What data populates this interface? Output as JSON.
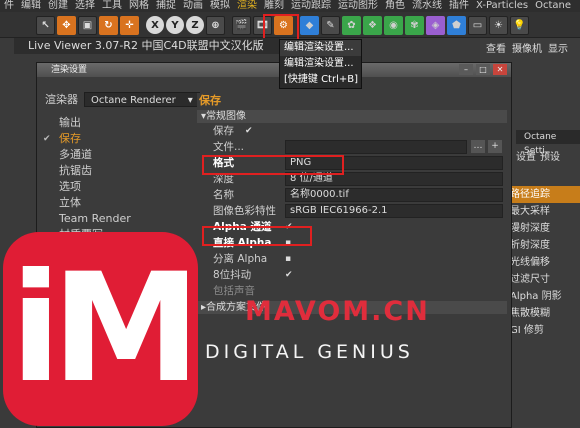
{
  "menubar": [
    "件",
    "编辑",
    "创建",
    "选择",
    "工具",
    "网格",
    "捕捉",
    "动画",
    "模拟",
    "渲染",
    "雕刻",
    "运动跟踪",
    "运动图形",
    "角色",
    "流水线",
    "插件",
    "X-Particles",
    "Octane"
  ],
  "toolbar": {
    "x": "X",
    "y": "Y",
    "z": "Z"
  },
  "popup": {
    "item1": "编辑渲染设置...",
    "item2": "编辑渲染设置...",
    "item3": "[快捷键 Ctrl+B]"
  },
  "live_viewer_title": "Live Viewer 3.07-R2 中国C4D联盟中文汉化版",
  "right_panel": {
    "tabs": [
      "查看",
      "摄像机",
      "显示"
    ],
    "octane_title": "Octane Setti...",
    "octane_tabs": [
      "设置",
      "预设"
    ],
    "list": [
      "路径追踪",
      "最大采样",
      "漫射深度",
      "折射深度",
      "光线偏移",
      "过滤尺寸",
      "Alpha 阴影",
      "焦散模糊",
      "GI 修剪"
    ]
  },
  "dialog": {
    "title": "渲染设置",
    "renderer_label": "渲染器",
    "renderer_value": "Octane Renderer",
    "nav": [
      {
        "label": "输出",
        "checked": false
      },
      {
        "label": "保存",
        "checked": true
      },
      {
        "label": "多通道",
        "checked": false
      },
      {
        "label": "抗锯齿",
        "checked": false
      },
      {
        "label": "选项",
        "checked": false
      },
      {
        "label": "立体",
        "checked": false
      },
      {
        "label": "Team Render",
        "checked": false
      },
      {
        "label": "材质覆写",
        "checked": false
      }
    ],
    "pane_title": "保存",
    "section_general": "常规图像",
    "rows": {
      "save": "保存",
      "file": "文件...",
      "format": "格式",
      "format_value": "PNG",
      "depth": "深度",
      "depth_value": "8 位/通道",
      "name": "名称",
      "name_value": "名称0000.tif",
      "color_profile": "图像色彩特性",
      "color_profile_value": "sRGB IEC61966-2.1",
      "alpha": "Alpha 通道",
      "straight_alpha": "直接 Alpha",
      "separate_alpha": "分离 Alpha",
      "dither": "8位抖动",
      "include_sound": "包括声音"
    },
    "section_composite": "合成方案文件"
  },
  "watermark": {
    "logo": "iM",
    "site": "MAVOM.CN",
    "tagline": "DIGITAL GENIUS"
  },
  "colors": {
    "accent": "#e59a28",
    "highlight_box": "#e02020",
    "logo": "#e01d35"
  }
}
